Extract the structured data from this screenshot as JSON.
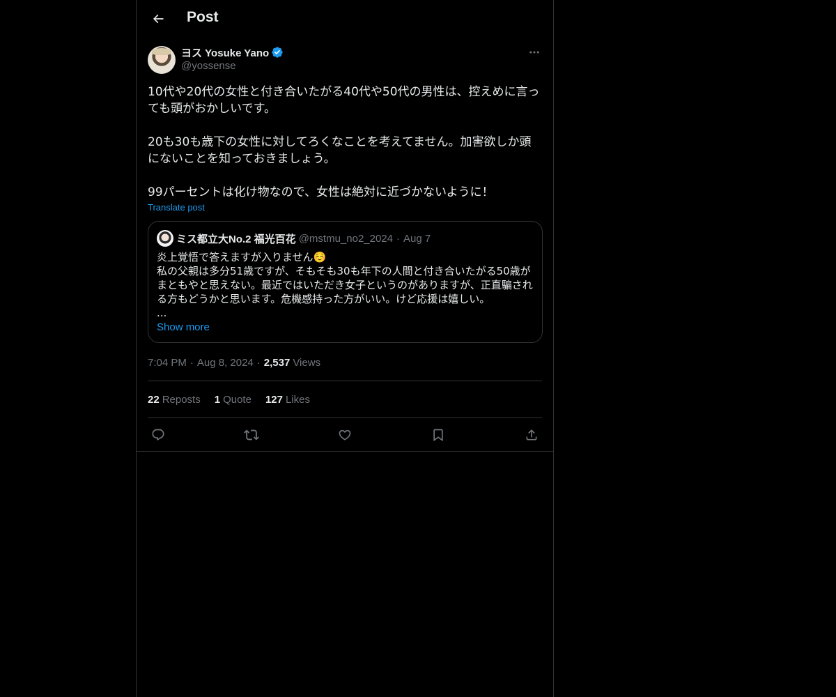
{
  "header": {
    "title": "Post"
  },
  "post": {
    "display_name": "ヨス Yosuke Yano",
    "handle": "@yossense",
    "body": "10代や20代の女性と付き合いたがる40代や50代の男性は、控えめに言っても頭がおかしいです。\n\n20も30も歳下の女性に対してろくなことを考えてません。加害欲しか頭にないことを知っておきましょう。\n\n99パーセントは化け物なので、女性は絶対に近づかないように！",
    "translate_label": "Translate post",
    "time": "7:04 PM",
    "date": "Aug 8, 2024",
    "views_count": "2,537",
    "views_label": "Views"
  },
  "quote": {
    "display_name": "ミス都立大No.2 福光百花",
    "handle": "@mstmu_no2_2024",
    "date": "Aug 7",
    "body": "炎上覚悟で答えますが入りません☺️\n私の父親は多分51歳ですが、そもそも30も年下の人間と付き合いたがる50歳がまともやと思えない。最近ではいただき女子というのがありますが、正直騙される方もどうかと思います。危機感持った方がいい。けど応援は嬉しい。\n...",
    "show_more": "Show more"
  },
  "stats": {
    "reposts_count": "22",
    "reposts_label": "Reposts",
    "quotes_count": "1",
    "quotes_label": "Quote",
    "likes_count": "127",
    "likes_label": "Likes"
  },
  "colors": {
    "background": "#000000",
    "text": "#e7e9ea",
    "muted": "#71767b",
    "accent": "#1d9bf0",
    "border": "#2f3336"
  },
  "icons": {
    "back": "arrow-left-icon",
    "verified": "verified-badge-icon",
    "more": "more-horizontal-icon",
    "reply": "reply-icon",
    "repost": "repost-icon",
    "like": "heart-icon",
    "bookmark": "bookmark-icon",
    "share": "share-icon"
  }
}
